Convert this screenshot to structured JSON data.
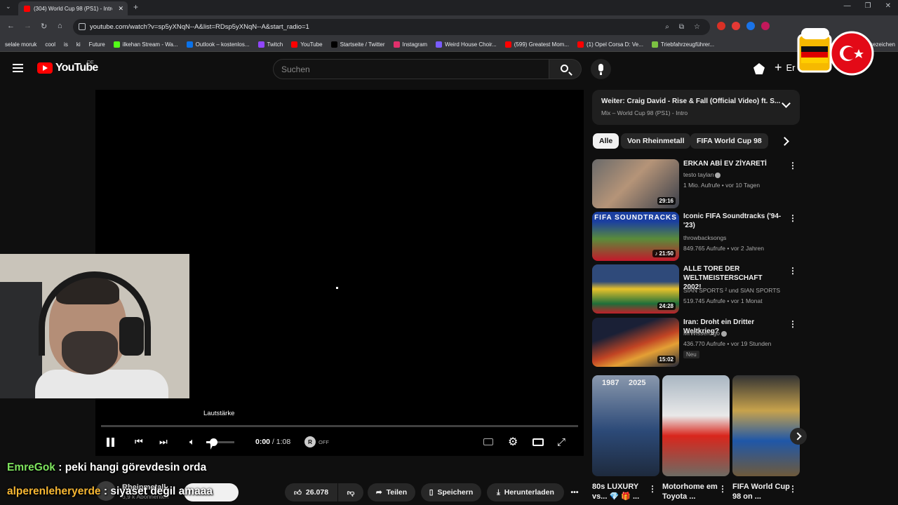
{
  "browser": {
    "tab_title": "(304) World Cup 98 (PS1) - Intro",
    "url": "youtube.com/watch?v=sp5yXNqN--A&list=RDsp5yXNqN--A&start_radio=1",
    "bookmarks": [
      {
        "label": "selale moruk",
        "color": "#35363a"
      },
      {
        "label": "cool",
        "color": "#35363a"
      },
      {
        "label": "is",
        "color": "#35363a"
      },
      {
        "label": "ki",
        "color": "#35363a"
      },
      {
        "label": "Future",
        "color": "#35363a"
      },
      {
        "label": "ilkehan Stream - Wa...",
        "color": "#53fc18"
      },
      {
        "label": "Outlook – kostenlos...",
        "color": "#0a72ea"
      },
      {
        "label": "Twitch",
        "color": "#9146ff"
      },
      {
        "label": "YouTube",
        "color": "#ff0000"
      },
      {
        "label": "Startseite / Twitter",
        "color": "#000000"
      },
      {
        "label": "Instagram",
        "color": "#e1306c"
      },
      {
        "label": "Weird House Choir...",
        "color": "#7a5cff"
      },
      {
        "label": "(599) Greatest Mom...",
        "color": "#ff0000"
      },
      {
        "label": "(1) Opel Corsa D: Ve...",
        "color": "#ff0000"
      },
      {
        "label": "Triebfahrzeugführer...",
        "color": "#7cc242"
      },
      {
        "label": "Lesezeichen",
        "color": "#35363a"
      }
    ]
  },
  "masthead": {
    "logo_text": "YouTube",
    "region": "DE",
    "search_placeholder": "Suchen",
    "create_label": "Er"
  },
  "player": {
    "tooltip": "Lautstärke",
    "time_current": "0:00",
    "time_sep": " / ",
    "time_duration": "1:08",
    "autoplay_label": "OFF",
    "autoplay_glyph": "R",
    "volume_level": 0.25
  },
  "chat": [
    {
      "user": "EmreGok",
      "text": " : peki hangi görevdesin orda"
    },
    {
      "user": "alperenleheryerde",
      "text": " : siyaset değil amaaa"
    }
  ],
  "below_player": {
    "channel_name": "Rheinmetall",
    "channel_subs": "6,9 k Abonnenten",
    "like_count": "26.078",
    "share_label": "Teilen",
    "save_label": "Speichern",
    "download_label": "Herunterladen"
  },
  "sidebar": {
    "upnext_title": "Weiter: Craig David - Rise & Fall (Official Video) ft. S...",
    "upnext_sub": "Mix – World Cup 98 (PS1) - Intro",
    "chips": [
      "Alle",
      "Von Rheinmetall",
      "FIFA World Cup 98"
    ],
    "videos": [
      {
        "title": "ERKAN ABİ EV ZİYARETİ",
        "channel": "testo taylan",
        "meta": "1 Mio. Aufrufe • vor 10 Tagen",
        "duration": "29:16",
        "badge": ""
      },
      {
        "title": "Iconic FIFA Soundtracks ('94-'23)",
        "channel": "throwbacksongs",
        "meta": "849.765 Aufrufe • vor 2 Jahren",
        "duration": "♪ 21:50",
        "badge": ""
      },
      {
        "title": "ALLE TORE DER WELTMEISTERSCHAFT 2002!",
        "channel": "SIAN SPORTS ² und SIAN SPORTS",
        "meta": "519.745 Aufrufe • vor 1 Monat",
        "duration": "24:28",
        "badge": ""
      },
      {
        "title": "Iran: Droht ein Dritter Weltkrieg?",
        "channel": "MrWissen2go",
        "meta": "436.770 Aufrufe • vor 19 Stunden",
        "duration": "15:02",
        "badge": "Neu"
      }
    ],
    "shorts": [
      {
        "title": "80s LUXURY vs... 💎 🎁 ..."
      },
      {
        "title": "Motorhome em Toyota ..."
      },
      {
        "title": "FIFA World Cup 98 on ..."
      }
    ],
    "shorts_label_1": "1987",
    "shorts_label_2": "2025",
    "thumb_label_fifa": "FIFA SOUNDTRACKS"
  }
}
